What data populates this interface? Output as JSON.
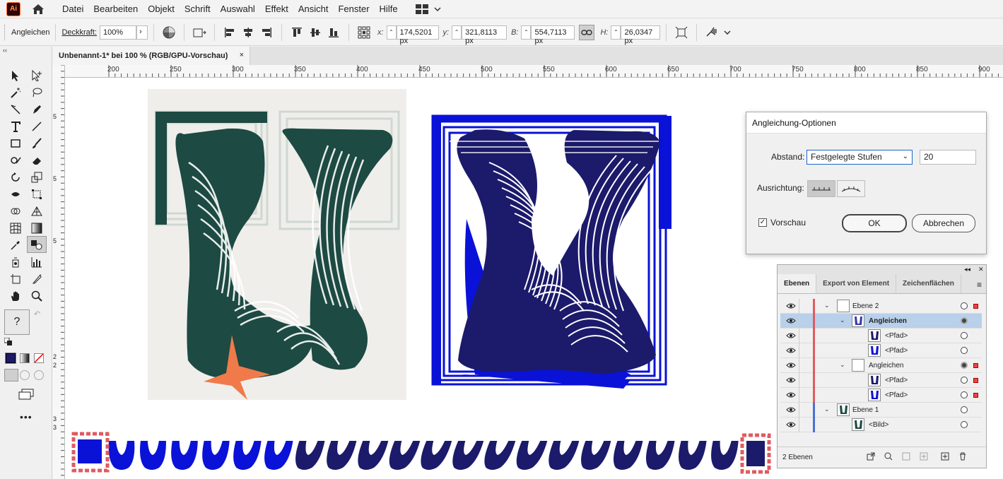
{
  "app": {
    "logo_text": "Ai"
  },
  "menu": [
    "Datei",
    "Bearbeiten",
    "Objekt",
    "Schrift",
    "Auswahl",
    "Effekt",
    "Ansicht",
    "Fenster",
    "Hilfe"
  ],
  "control": {
    "object_label": "Angleichen",
    "opacity_label": "Deckkraft:",
    "opacity_value": "100%",
    "x_label": "x:",
    "x_value": "174,5201 px",
    "y_label": "y:",
    "y_value": "321,8113 px",
    "w_label": "B:",
    "w_value": "554,7113 px",
    "h_label": "H:",
    "h_value": "26,0347 px"
  },
  "document": {
    "tab_title": "Unbenannt-1* bei 100 % (RGB/GPU-Vorschau)",
    "close_glyph": "×"
  },
  "ruler_top": [
    "200",
    "250",
    "300",
    "350",
    "400",
    "450",
    "500",
    "550",
    "600",
    "650",
    "700",
    "750",
    "800",
    "850",
    "900"
  ],
  "ruler_left": [
    "5",
    "5",
    "5",
    "2",
    "2",
    "3",
    "3"
  ],
  "dialog": {
    "title": "Angleichung-Optionen",
    "spacing_label": "Abstand:",
    "spacing_value": "Festgelegte Stufen",
    "steps_value": "20",
    "orientation_label": "Ausrichtung:",
    "preview_label": "Vorschau",
    "preview_checked": true,
    "ok_label": "OK",
    "cancel_label": "Abbrechen"
  },
  "layers_panel": {
    "tabs": [
      "Ebenen",
      "Export von Element",
      "Zeichenflächen"
    ],
    "rows": [
      {
        "name": "Ebene 2",
        "bold": false
      },
      {
        "name": "Angleichen",
        "bold": true
      },
      {
        "name": "<Pfad>",
        "bold": false
      },
      {
        "name": "<Pfad>",
        "bold": false
      },
      {
        "name": "Angleichen",
        "bold": false
      },
      {
        "name": "<Pfad>",
        "bold": false
      },
      {
        "name": "<Pfad>",
        "bold": false
      },
      {
        "name": "Ebene 1",
        "bold": false
      },
      {
        "name": "<Bild>",
        "bold": false
      }
    ],
    "footer_count": "2 Ebenen"
  },
  "colors": {
    "accent_blue": "#0a12d8",
    "dark_navy": "#1c1a6b",
    "dark_green": "#1d4a42",
    "star_orange": "#f07a4a",
    "layer_red": "#e05a60",
    "layer_blue": "#4a6fd8",
    "selection_bg": "#b8d0ea"
  },
  "tools": {
    "fill_unknown": "?"
  }
}
